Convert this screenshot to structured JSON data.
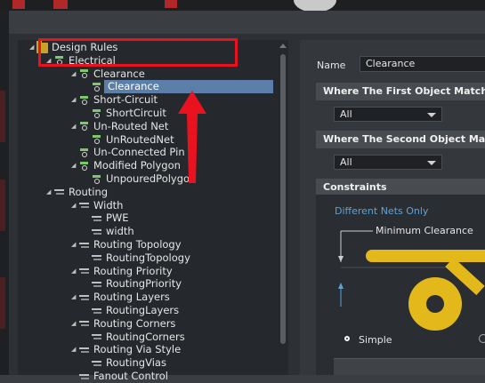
{
  "tree": {
    "items": [
      {
        "label": "Design Rules",
        "icon": "folder-icon",
        "level": 0
      },
      {
        "label": "Electrical",
        "icon": "rule-icon",
        "level": 1
      },
      {
        "label": "Clearance",
        "icon": "rule-icon",
        "level": 2
      },
      {
        "label": "Clearance",
        "icon": "rule-icon",
        "level": 3,
        "selected": true
      },
      {
        "label": "Short-Circuit",
        "icon": "rule-icon",
        "level": 2
      },
      {
        "label": "ShortCircuit",
        "icon": "rule-icon",
        "level": 3
      },
      {
        "label": "Un-Routed Net",
        "icon": "rule-icon",
        "level": 2
      },
      {
        "label": "UnRoutedNet",
        "icon": "rule-icon",
        "level": 3
      },
      {
        "label": "Un-Connected Pin",
        "icon": "rule-icon",
        "level": 2
      },
      {
        "label": "Modified Polygon",
        "icon": "rule-icon",
        "level": 2
      },
      {
        "label": "UnpouredPolygon",
        "icon": "rule-icon",
        "level": 3
      },
      {
        "label": "Routing",
        "icon": "routing-icon",
        "level": 1
      },
      {
        "label": "Width",
        "icon": "routing-icon",
        "level": 2
      },
      {
        "label": "PWE",
        "icon": "routing-icon",
        "level": 3
      },
      {
        "label": "width",
        "icon": "routing-icon",
        "level": 3
      },
      {
        "label": "Routing Topology",
        "icon": "routing-icon",
        "level": 2
      },
      {
        "label": "RoutingTopology",
        "icon": "routing-icon",
        "level": 3
      },
      {
        "label": "Routing Priority",
        "icon": "routing-icon",
        "level": 2
      },
      {
        "label": "RoutingPriority",
        "icon": "routing-icon",
        "level": 3
      },
      {
        "label": "Routing Layers",
        "icon": "routing-icon",
        "level": 2
      },
      {
        "label": "RoutingLayers",
        "icon": "routing-icon",
        "level": 3
      },
      {
        "label": "Routing Corners",
        "icon": "routing-icon",
        "level": 2
      },
      {
        "label": "RoutingCorners",
        "icon": "routing-icon",
        "level": 3
      },
      {
        "label": "Routing Via Style",
        "icon": "routing-icon",
        "level": 2
      },
      {
        "label": "RoutingVias",
        "icon": "routing-icon",
        "level": 3
      },
      {
        "label": "Fanout Control",
        "icon": "routing-icon",
        "level": 2
      }
    ]
  },
  "rule": {
    "name_label": "Name",
    "name_value": "Clearance",
    "first_match_header": "Where The First Object Matches",
    "first_match_value": "All",
    "second_match_header": "Where The Second Object Matches",
    "second_match_value": "All",
    "constraints_header": "Constraints",
    "different_nets": "Different Nets Only",
    "min_clearance": "Minimum Clearance",
    "mode_simple": "Simple"
  },
  "colors": {
    "annotation": "#e8131f",
    "selection": "#5b7fa8",
    "pad_yellow": "#e3b81b",
    "link_blue": "#5ca3d6"
  }
}
